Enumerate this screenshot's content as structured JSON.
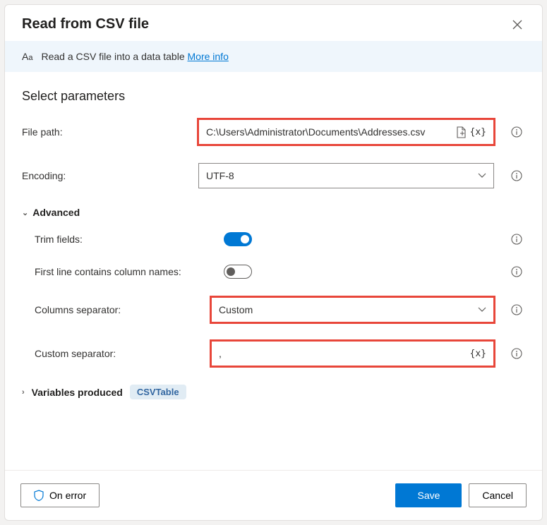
{
  "dialog": {
    "title": "Read from CSV file",
    "banner_text": "Read a CSV file into a data table ",
    "banner_link": "More info"
  },
  "section_title": "Select parameters",
  "fields": {
    "file_path": {
      "label": "File path:",
      "value": "C:\\Users\\Administrator\\Documents\\Addresses.csv"
    },
    "encoding": {
      "label": "Encoding:",
      "value": "UTF-8"
    },
    "trim_fields": {
      "label": "Trim fields:"
    },
    "first_line": {
      "label": "First line contains column names:"
    },
    "columns_separator": {
      "label": "Columns separator:",
      "value": "Custom"
    },
    "custom_separator": {
      "label": "Custom separator:",
      "value": ","
    }
  },
  "advanced_label": "Advanced",
  "variables": {
    "label": "Variables produced",
    "pill": "CSVTable"
  },
  "footer": {
    "on_error": "On error",
    "save": "Save",
    "cancel": "Cancel"
  },
  "icons": {
    "fx": "{x}"
  }
}
